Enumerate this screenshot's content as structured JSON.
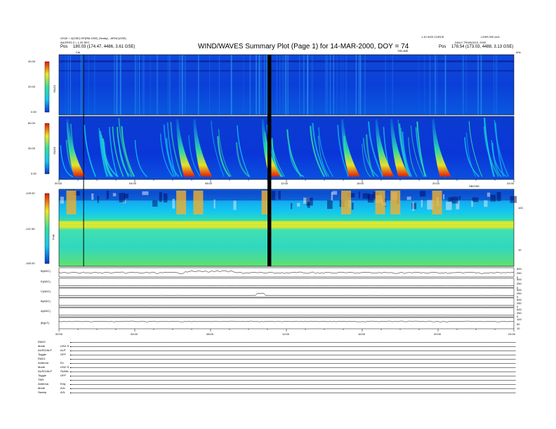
{
  "header": {
    "left_line1": "GS30 + 2(GSE) HP(RM-GSE) (Yealty) - AFMC(GSE)",
    "left_line2": "A&GRSS.3 = 1.20 SEC",
    "left_pos_label": "Pos",
    "left_pos_value": "180.03 (174.47, 4486, 3.61 GSE)",
    "title": "WIND/WAVES Summary Plot (Page 1) for 14-MAR-2000, DOY = 74",
    "right_line1": "1.10 W20 CURCE",
    "right_line2": "DAILY TRUE(0110, 2000",
    "right_corner": "L2HR.000 rev1",
    "right_pos_label": "Pos",
    "right_pos_value": "178.54 (173.03, 4488, 3.13 GSE)",
    "top_marker_left": "Cal",
    "top_marker_right": "TIELIME",
    "axis_top_right": "kHz"
  },
  "rad2": {
    "label": "RAD2",
    "colorbar_ticks": [
      "40.00",
      "20.00",
      "0.00"
    ]
  },
  "rad1": {
    "label": "RAD1",
    "colorbar_ticks": [
      "60.00",
      "30.00",
      "0.00"
    ]
  },
  "time_axis": {
    "ticks": [
      "00:00",
      "04:00",
      "08:00",
      "12:00",
      "16:00",
      "20:00",
      "24:00"
    ],
    "units_label": "SB/GSE"
  },
  "tnr": {
    "label": "TNR",
    "colorbar_ticks": [
      "-125.00",
      "-137.50",
      "-150.00"
    ],
    "right_ticks": [
      "100",
      "10"
    ]
  },
  "traces": [
    {
      "label": "B(ADC)",
      "right_ticks": [
        "500",
        "250",
        "0"
      ]
    },
    {
      "label": "E(ADC)",
      "right_ticks": [
        "500",
        "250",
        "0"
      ]
    },
    {
      "label": "C(ADC)",
      "right_ticks": [
        "500",
        "250",
        "0"
      ]
    },
    {
      "label": "B(ADC)",
      "right_ticks": [
        "500",
        "250",
        "0"
      ]
    },
    {
      "label": "A(ADC)",
      "right_ticks": [
        "500",
        "250",
        "0"
      ]
    },
    {
      "label": "|B|(nT)",
      "right_ticks": [
        "100",
        "50",
        "10"
      ]
    }
  ],
  "bottom_time_ticks": [
    "00:00",
    "04:00",
    "08:00",
    "12:00",
    "16:00",
    "20:00",
    "24:00"
  ],
  "meta": [
    {
      "key": "RAD2",
      "val": ""
    },
    {
      "key": "Mode",
      "val": "LIN1 S"
    },
    {
      "key": "AUSO/ALP",
      "val": "ALP"
    },
    {
      "key": "Toggle",
      "val": "OFF"
    },
    {
      "key": "RAD1",
      "val": ""
    },
    {
      "key": "Antenna",
      "val": "Ex"
    },
    {
      "key": "Mode",
      "val": "LIN2 S"
    },
    {
      "key": "AUSO/ALP",
      "val": "SUMA"
    },
    {
      "key": "Toggle",
      "val": "OFF"
    },
    {
      "key": "TNR",
      "val": ""
    },
    {
      "key": "Antenna",
      "val": "Exly"
    },
    {
      "key": "Mode",
      "val": "A2L"
    },
    {
      "key": "Sweep",
      "val": "A2L"
    }
  ],
  "colors": {
    "background_blue": "#0a36d8",
    "cyan": "#14c8f0",
    "green": "#30e0a0",
    "yellow": "#f0e820",
    "red": "#e81800",
    "gap": "#000000"
  },
  "chart_data": {
    "type": "heatmap",
    "title": "WIND/WAVES Summary Plot (Page 1) for 14-MAR-2000, DOY = 74",
    "x_range_hours": [
      0,
      24
    ],
    "panels": [
      {
        "name": "RAD2",
        "colorbar_range": [
          0,
          40
        ]
      },
      {
        "name": "RAD1",
        "colorbar_range": [
          0,
          60
        ]
      },
      {
        "name": "TNR",
        "colorbar_range": [
          -150,
          -125
        ]
      }
    ],
    "data_gap_hours": [
      11.0,
      11.2
    ],
    "cal_marker_hour": 1.3,
    "radio_bursts_hours": [
      0.5,
      6.3,
      7.2,
      10.8,
      15.0,
      16.8,
      17.6,
      19.8
    ],
    "tnr_plasma_line_level": -136
  }
}
